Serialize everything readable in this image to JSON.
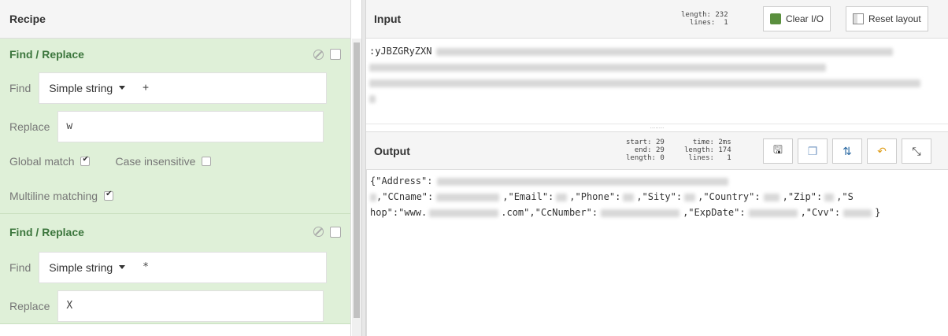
{
  "recipe": {
    "title": "Recipe",
    "operations": [
      {
        "name": "Find / Replace",
        "find_label": "Find",
        "find_type": "Simple string",
        "find_value": "+",
        "replace_label": "Replace",
        "replace_value": "w",
        "global_match_label": "Global match",
        "global_match": true,
        "case_insensitive_label": "Case insensitive",
        "case_insensitive": false,
        "multiline_label": "Multiline matching",
        "multiline": true
      },
      {
        "name": "Find / Replace",
        "find_label": "Find",
        "find_type": "Simple string",
        "find_value": "*",
        "replace_label": "Replace",
        "replace_value": "X"
      }
    ]
  },
  "input": {
    "title": "Input",
    "stats": {
      "length_label": "length:",
      "length": "232",
      "lines_label": "lines:",
      "lines": "1"
    },
    "clear_label": "Clear I/O",
    "reset_label": "Reset layout",
    "text_prefix": ":yJBZGRyZXN"
  },
  "output": {
    "title": "Output",
    "stats": {
      "start_label": "start:",
      "start": "29",
      "end_label": "end:",
      "end": "29",
      "length_label": "length:",
      "length": "0",
      "time_label": "time:",
      "time": "2ms",
      "out_length_label": "length:",
      "out_length": "174",
      "lines_label": "lines:",
      "lines": "1"
    },
    "line1_a": "{\"Address\":",
    "line2_a": ",\"CCname\":",
    "line2_b": ",\"Email\":",
    "line2_c": ",\"Phone\":",
    "line2_d": ",\"Sity\":",
    "line2_e": ",\"Country\":",
    "line2_f": ",\"Zip\":",
    "line2_g": ",\"S",
    "line3_a": "hop\":\"www.",
    "line3_b": ".com\",\"CcNumber\":",
    "line3_c": ",\"ExpDate\":",
    "line3_d": ",\"Cvv\":",
    "line3_e": "}"
  }
}
